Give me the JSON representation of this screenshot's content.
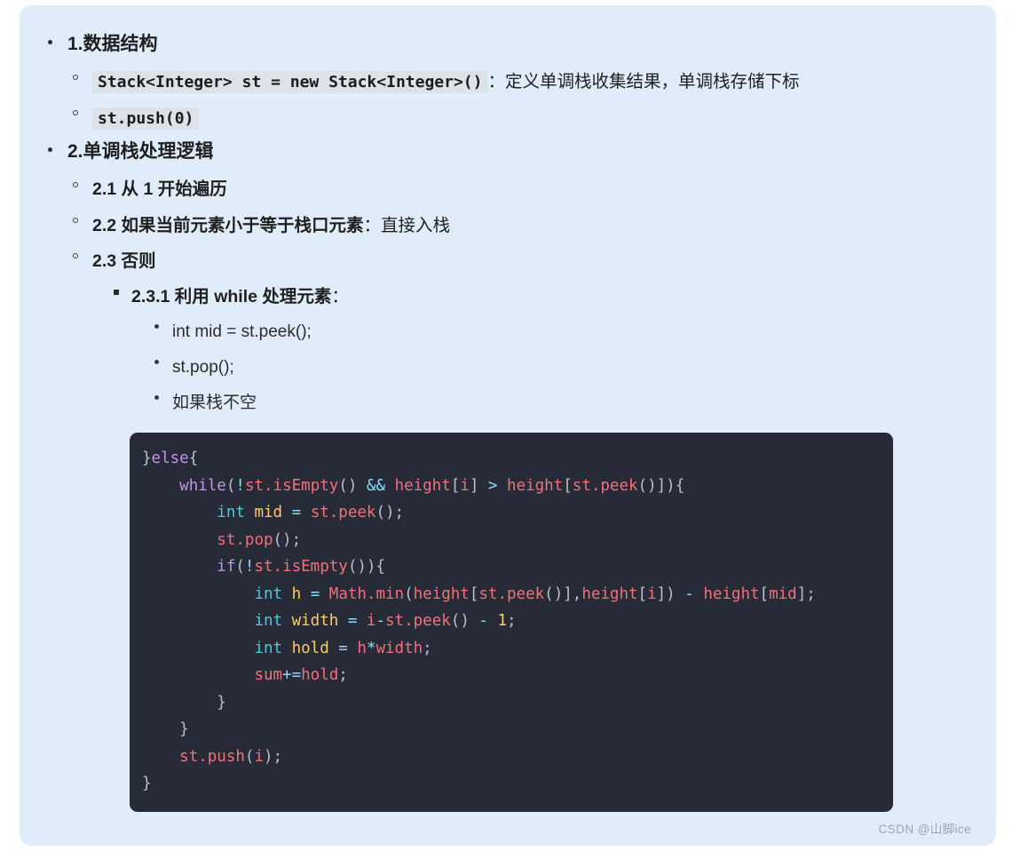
{
  "outline": {
    "items": [
      {
        "id": "sec1",
        "label": "1.数据结构",
        "children": [
          {
            "id": "sec1-1",
            "code": "Stack<Integer> st = new Stack<Integer>()",
            "text": "：定义单调栈收集结果，单调栈存储下标"
          },
          {
            "id": "sec1-2",
            "code": "st.push(0)",
            "text": ""
          }
        ]
      },
      {
        "id": "sec2",
        "label": "2.单调栈处理逻辑",
        "children": [
          {
            "id": "sec2-1",
            "label": "2.1 从 1 开始遍历",
            "tail": ""
          },
          {
            "id": "sec2-2",
            "label": "2.2 如果当前元素小于等于栈口元素",
            "tail": "：直接入栈"
          },
          {
            "id": "sec2-3",
            "label": "2.3 否则",
            "tail": ""
          }
        ]
      }
    ],
    "level3": {
      "label": "2.3.1 利用 while 处理元素",
      "tail": "："
    },
    "level4": [
      "int mid = st.peek();",
      "st.pop();",
      "如果栈不空"
    ]
  },
  "code_block": {
    "language": "java",
    "lines": [
      [
        {
          "t": "}",
          "c": "tk-pun"
        },
        {
          "t": "else",
          "c": "tk-key"
        },
        {
          "t": "{",
          "c": "tk-pun"
        }
      ],
      [
        {
          "t": "    ",
          "c": "tk-pun"
        },
        {
          "t": "while",
          "c": "tk-key"
        },
        {
          "t": "(",
          "c": "tk-pun"
        },
        {
          "t": "!",
          "c": "tk-op"
        },
        {
          "t": "st.isEmpty",
          "c": "tk-fn"
        },
        {
          "t": "() ",
          "c": "tk-pun"
        },
        {
          "t": "&&",
          "c": "tk-op"
        },
        {
          "t": " ",
          "c": "tk-pun"
        },
        {
          "t": "height",
          "c": "tk-fn"
        },
        {
          "t": "[",
          "c": "tk-pun"
        },
        {
          "t": "i",
          "c": "tk-fn"
        },
        {
          "t": "] ",
          "c": "tk-pun"
        },
        {
          "t": ">",
          "c": "tk-op"
        },
        {
          "t": " ",
          "c": "tk-pun"
        },
        {
          "t": "height",
          "c": "tk-fn"
        },
        {
          "t": "[",
          "c": "tk-pun"
        },
        {
          "t": "st.peek",
          "c": "tk-fn"
        },
        {
          "t": "()]){",
          "c": "tk-pun"
        }
      ],
      [
        {
          "t": "        ",
          "c": "tk-pun"
        },
        {
          "t": "int",
          "c": "tk-typ"
        },
        {
          "t": " ",
          "c": "tk-pun"
        },
        {
          "t": "mid",
          "c": "tk-var"
        },
        {
          "t": " ",
          "c": "tk-pun"
        },
        {
          "t": "=",
          "c": "tk-op"
        },
        {
          "t": " ",
          "c": "tk-pun"
        },
        {
          "t": "st.peek",
          "c": "tk-fn"
        },
        {
          "t": "();",
          "c": "tk-pun"
        }
      ],
      [
        {
          "t": "        ",
          "c": "tk-pun"
        },
        {
          "t": "st.pop",
          "c": "tk-fn"
        },
        {
          "t": "();",
          "c": "tk-pun"
        }
      ],
      [
        {
          "t": "        ",
          "c": "tk-pun"
        },
        {
          "t": "if",
          "c": "tk-key"
        },
        {
          "t": "(",
          "c": "tk-pun"
        },
        {
          "t": "!",
          "c": "tk-op"
        },
        {
          "t": "st.isEmpty",
          "c": "tk-fn"
        },
        {
          "t": "()){",
          "c": "tk-pun"
        }
      ],
      [
        {
          "t": "            ",
          "c": "tk-pun"
        },
        {
          "t": "int",
          "c": "tk-typ"
        },
        {
          "t": " ",
          "c": "tk-pun"
        },
        {
          "t": "h",
          "c": "tk-var"
        },
        {
          "t": " ",
          "c": "tk-pun"
        },
        {
          "t": "=",
          "c": "tk-op"
        },
        {
          "t": " ",
          "c": "tk-pun"
        },
        {
          "t": "Math.min",
          "c": "tk-fn"
        },
        {
          "t": "(",
          "c": "tk-pun"
        },
        {
          "t": "height",
          "c": "tk-fn"
        },
        {
          "t": "[",
          "c": "tk-pun"
        },
        {
          "t": "st.peek",
          "c": "tk-fn"
        },
        {
          "t": "()],",
          "c": "tk-pun"
        },
        {
          "t": "height",
          "c": "tk-fn"
        },
        {
          "t": "[",
          "c": "tk-pun"
        },
        {
          "t": "i",
          "c": "tk-fn"
        },
        {
          "t": "]) ",
          "c": "tk-pun"
        },
        {
          "t": "-",
          "c": "tk-op"
        },
        {
          "t": " ",
          "c": "tk-pun"
        },
        {
          "t": "height",
          "c": "tk-fn"
        },
        {
          "t": "[",
          "c": "tk-pun"
        },
        {
          "t": "mid",
          "c": "tk-fn"
        },
        {
          "t": "];",
          "c": "tk-pun"
        }
      ],
      [
        {
          "t": "            ",
          "c": "tk-pun"
        },
        {
          "t": "int",
          "c": "tk-typ"
        },
        {
          "t": " ",
          "c": "tk-pun"
        },
        {
          "t": "width",
          "c": "tk-var"
        },
        {
          "t": " ",
          "c": "tk-pun"
        },
        {
          "t": "=",
          "c": "tk-op"
        },
        {
          "t": " ",
          "c": "tk-pun"
        },
        {
          "t": "i",
          "c": "tk-fn"
        },
        {
          "t": "-",
          "c": "tk-op"
        },
        {
          "t": "st.peek",
          "c": "tk-fn"
        },
        {
          "t": "() ",
          "c": "tk-pun"
        },
        {
          "t": "-",
          "c": "tk-op"
        },
        {
          "t": " ",
          "c": "tk-pun"
        },
        {
          "t": "1",
          "c": "tk-num"
        },
        {
          "t": ";",
          "c": "tk-pun"
        }
      ],
      [
        {
          "t": "            ",
          "c": "tk-pun"
        },
        {
          "t": "int",
          "c": "tk-typ"
        },
        {
          "t": " ",
          "c": "tk-pun"
        },
        {
          "t": "hold",
          "c": "tk-var"
        },
        {
          "t": " ",
          "c": "tk-pun"
        },
        {
          "t": "=",
          "c": "tk-op"
        },
        {
          "t": " ",
          "c": "tk-pun"
        },
        {
          "t": "h",
          "c": "tk-fn"
        },
        {
          "t": "*",
          "c": "tk-op"
        },
        {
          "t": "width",
          "c": "tk-fn"
        },
        {
          "t": ";",
          "c": "tk-pun"
        }
      ],
      [
        {
          "t": "            ",
          "c": "tk-pun"
        },
        {
          "t": "sum",
          "c": "tk-fn"
        },
        {
          "t": "+=",
          "c": "tk-op"
        },
        {
          "t": "hold",
          "c": "tk-fn"
        },
        {
          "t": ";",
          "c": "tk-pun"
        }
      ],
      [
        {
          "t": "        }",
          "c": "tk-pun"
        }
      ],
      [
        {
          "t": "    }",
          "c": "tk-pun"
        }
      ],
      [
        {
          "t": "    ",
          "c": "tk-pun"
        },
        {
          "t": "st.push",
          "c": "tk-fn"
        },
        {
          "t": "(",
          "c": "tk-pun"
        },
        {
          "t": "i",
          "c": "tk-fn"
        },
        {
          "t": ");",
          "c": "tk-pun"
        }
      ],
      [
        {
          "t": "}",
          "c": "tk-pun"
        }
      ]
    ]
  },
  "watermark": "CSDN @山脚ice",
  "colors": {
    "page_bg": "#e1ecfb",
    "code_bg": "#272b38",
    "inline_code_bg": "#dde1e8",
    "keyword": "#c792ea",
    "function": "#f07178",
    "operator": "#89ddff",
    "type": "#4ec9d8",
    "variable": "#ffcb6b",
    "punctuation": "#b9c0cc"
  }
}
